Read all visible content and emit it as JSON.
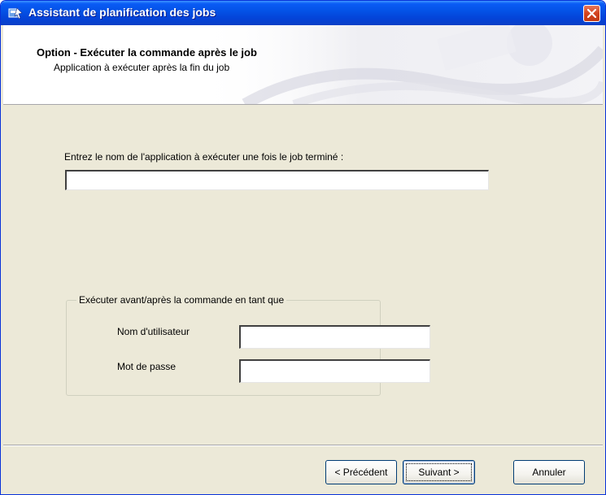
{
  "window": {
    "title": "Assistant de planification des jobs",
    "icon": "wizard-icon",
    "close_icon": "close-icon"
  },
  "header": {
    "title": "Option - Exécuter la commande après le job",
    "subtitle": "Application à exécuter après la fin du job"
  },
  "form": {
    "app_label": "Entrez le nom de l'application à exécuter une fois le job terminé :",
    "app_value": "",
    "group_title": "Exécuter avant/après la commande en tant que",
    "user_label": "Nom d'utilisateur",
    "user_value": "",
    "password_label": "Mot de passe",
    "password_value": ""
  },
  "buttons": {
    "previous": "< Précédent",
    "next": "Suivant >",
    "cancel": "Annuler"
  },
  "colors": {
    "titlebar": "#0453e7",
    "dialog_bg": "#ece9d8",
    "close_button": "#d3431e"
  }
}
